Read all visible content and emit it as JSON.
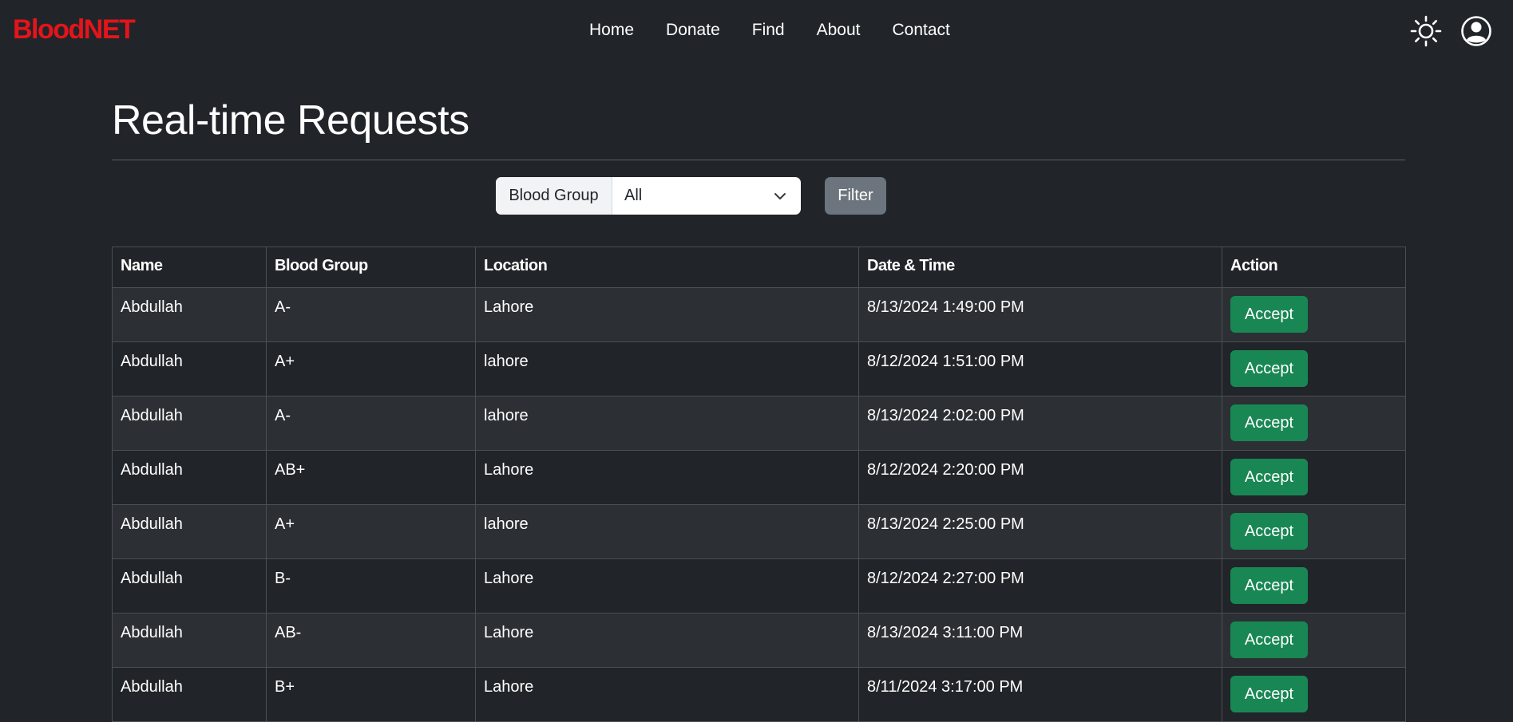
{
  "navbar": {
    "brand": "BloodNET",
    "links": [
      "Home",
      "Donate",
      "Find",
      "About",
      "Contact"
    ],
    "theme_icon": "sun-icon",
    "profile_icon": "user-circle-icon"
  },
  "main": {
    "title": "Real-time Requests",
    "filter": {
      "label": "Blood Group",
      "selected": "All",
      "button_label": "Filter"
    },
    "table": {
      "headers": [
        "Name",
        "Blood Group",
        "Location",
        "Date & Time",
        "Action"
      ],
      "rows": [
        {
          "name": "Abdullah",
          "group": "A-",
          "location": "Lahore",
          "datetime": "8/13/2024 1:49:00 PM",
          "action": "Accept"
        },
        {
          "name": "Abdullah",
          "group": "A+",
          "location": "lahore",
          "datetime": "8/12/2024 1:51:00 PM",
          "action": "Accept"
        },
        {
          "name": "Abdullah",
          "group": "A-",
          "location": "lahore",
          "datetime": "8/13/2024 2:02:00 PM",
          "action": "Accept"
        },
        {
          "name": "Abdullah",
          "group": "AB+",
          "location": "Lahore",
          "datetime": "8/12/2024 2:20:00 PM",
          "action": "Accept"
        },
        {
          "name": "Abdullah",
          "group": "A+",
          "location": "lahore",
          "datetime": "8/13/2024 2:25:00 PM",
          "action": "Accept"
        },
        {
          "name": "Abdullah",
          "group": "B-",
          "location": "Lahore",
          "datetime": "8/12/2024 2:27:00 PM",
          "action": "Accept"
        },
        {
          "name": "Abdullah",
          "group": "AB-",
          "location": "Lahore",
          "datetime": "8/13/2024 3:11:00 PM",
          "action": "Accept"
        },
        {
          "name": "Abdullah",
          "group": "B+",
          "location": "Lahore",
          "datetime": "8/11/2024 3:17:00 PM",
          "action": "Accept"
        }
      ]
    }
  },
  "colors": {
    "background": "#212529",
    "brand": "#e4141b",
    "accept": "#198754",
    "filter_button": "#6c757d",
    "row_striped": "#2c3034"
  }
}
